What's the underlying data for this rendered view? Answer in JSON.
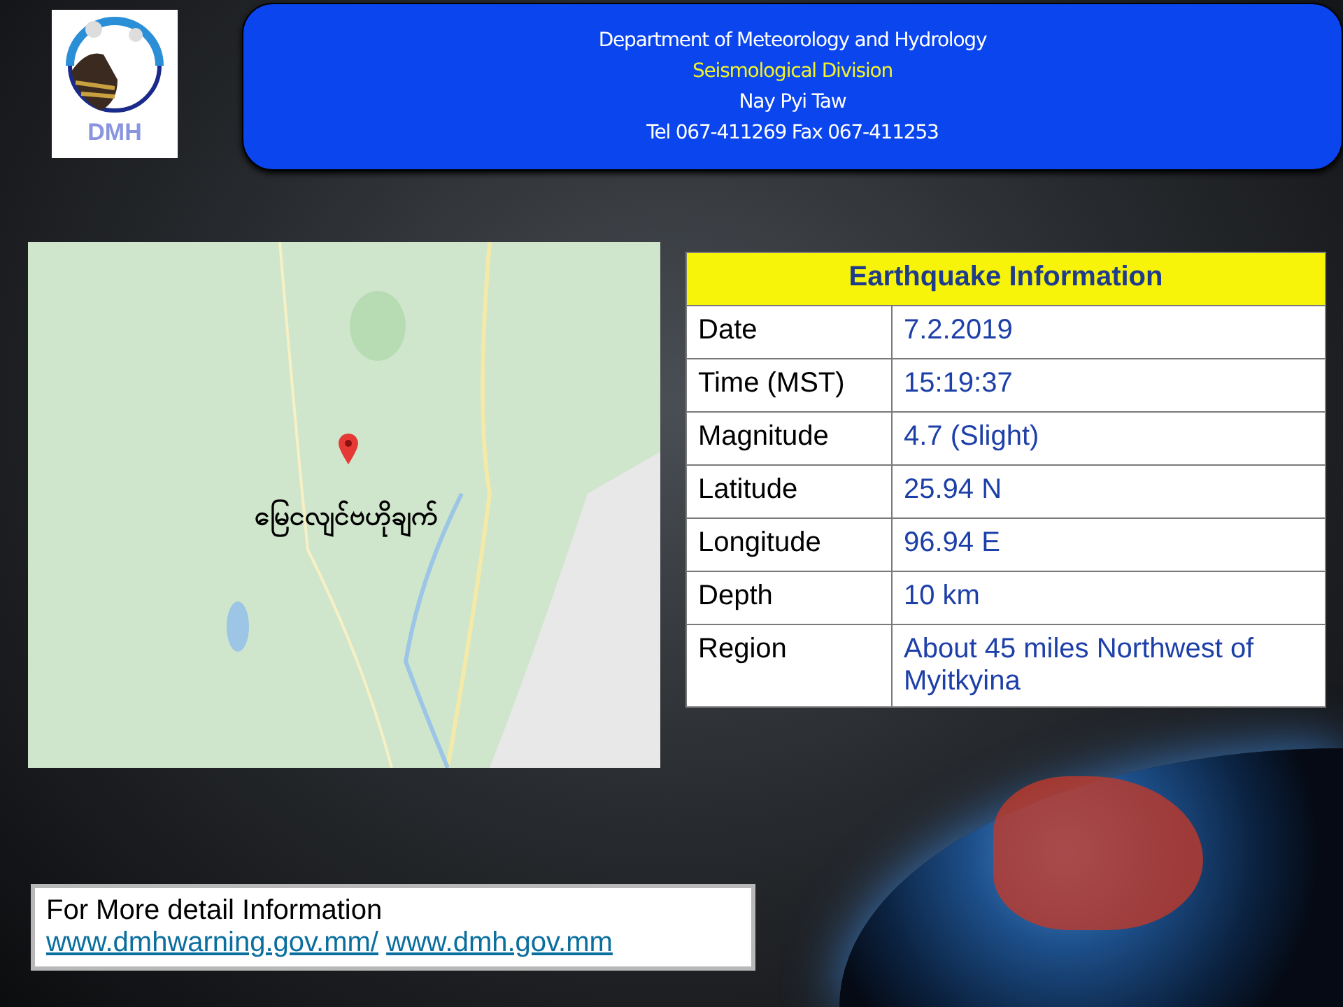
{
  "header": {
    "logo": {
      "text": "DMH"
    },
    "lines": [
      {
        "text": "Department of Meteorology and Hydrology",
        "kind": "plain"
      },
      {
        "text": "Seismological Division",
        "kind": "highlight"
      },
      {
        "text": "Nay Pyi Taw",
        "kind": "plain"
      },
      {
        "text": "Tel 067-411269 Fax 067-411253",
        "kind": "plain"
      }
    ]
  },
  "map": {
    "epicenter_label": "မြေငလျင်ဗဟိုချက်"
  },
  "table": {
    "title": "Earthquake Information",
    "rows": [
      {
        "label": "Date",
        "value": "7.2.2019"
      },
      {
        "label": "Time (MST)",
        "value": "15:19:37"
      },
      {
        "label": "Magnitude",
        "value": "4.7 (Slight)"
      },
      {
        "label": "Latitude",
        "value": "25.94 N"
      },
      {
        "label": "Longitude",
        "value": "96.94 E"
      },
      {
        "label": "Depth",
        "value": "10 km"
      },
      {
        "label": "Region",
        "value": "About 45 miles Northwest of Myitkyina"
      }
    ]
  },
  "footer": {
    "text": "For More detail Information",
    "links": [
      "www.dmhwarning.gov.mm/",
      "www.dmh.gov.mm"
    ]
  }
}
